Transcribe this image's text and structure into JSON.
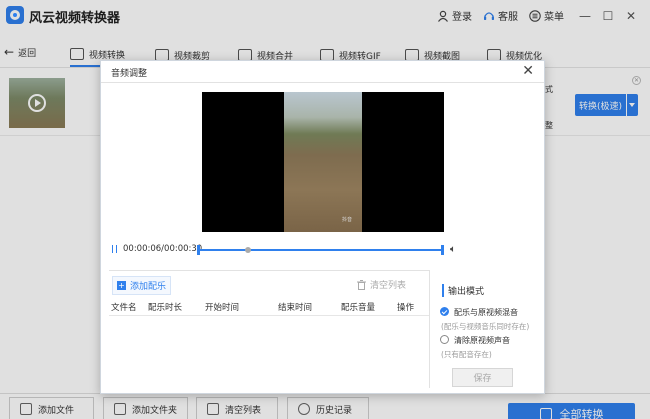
{
  "app": {
    "title": "风云视频转换器",
    "login": "登录",
    "support": "客服",
    "menu": "菜单"
  },
  "nav": {
    "back": "返回",
    "tabs": [
      {
        "label": "视频转换",
        "icon": "video-convert-icon"
      },
      {
        "label": "视频裁剪",
        "icon": "video-crop-icon"
      },
      {
        "label": "视频合并",
        "icon": "video-merge-icon"
      },
      {
        "label": "视频转GIF",
        "icon": "gif-icon"
      },
      {
        "label": "视频截图",
        "icon": "screenshot-icon"
      },
      {
        "label": "视频优化",
        "icon": "optimize-icon"
      }
    ]
  },
  "file_row": {
    "side_labels": [
      "式",
      "整"
    ],
    "convert_label": "转换(极速)"
  },
  "bottom": {
    "add_file": "添加文件",
    "add_folder": "添加文件夹",
    "clear_list": "清空列表",
    "history": "历史记录",
    "start": "全部转换"
  },
  "modal": {
    "title": "音频调整",
    "time": "00:00:06/00:00:30",
    "progress_fraction": 0.2,
    "add_music": "添加配乐",
    "clear_list": "清空列表",
    "columns": [
      "文件名",
      "配乐时长",
      "开始时间",
      "结束时间",
      "配乐音量",
      "操作"
    ],
    "output_mode": {
      "title": "输出模式",
      "options": [
        {
          "label": "配乐与原视频混音",
          "note": "(配乐与视频音乐同时存在)",
          "checked": true
        },
        {
          "label": "清除原视频声音",
          "note": "(只有配音存在)",
          "checked": false
        }
      ]
    },
    "save": "保存",
    "watermark": "抖音"
  },
  "colors": {
    "accent": "#2f80ed"
  }
}
